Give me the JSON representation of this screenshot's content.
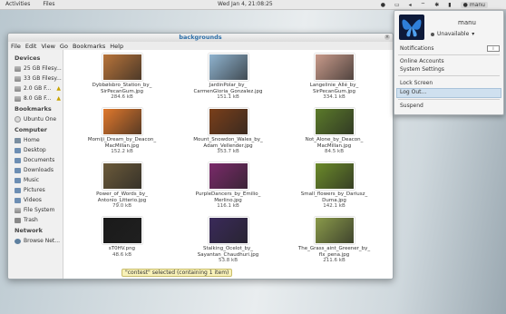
{
  "topbar": {
    "activities": "Activities",
    "files": "Files",
    "clock": "Wed Jan  4, 21:08:25",
    "user": "manu"
  },
  "window": {
    "title": "backgrounds",
    "menus": [
      "File",
      "Edit",
      "View",
      "Go",
      "Bookmarks",
      "Help"
    ]
  },
  "sidebar": {
    "devices_heading": "Devices",
    "devices": [
      "25 GB Filesy...",
      "33 GB Filesy...",
      "2.0 GB F...",
      "8.0 GB F..."
    ],
    "bookmarks_heading": "Bookmarks",
    "bookmarks": [
      "Ubuntu One"
    ],
    "computer_heading": "Computer",
    "computer": [
      "Home",
      "Desktop",
      "Documents",
      "Downloads",
      "Music",
      "Pictures",
      "Videos",
      "File System",
      "Trash"
    ],
    "network_heading": "Network",
    "network": [
      "Browse Net..."
    ]
  },
  "files": [
    {
      "name": "Dybbølsbro_Station_by_ SirPecanGum.jpg",
      "size": "284.6 kB",
      "color": "#b8743a"
    },
    {
      "name": "JardinPolar_by_ CarmenGloria_Gonzalez.jpg",
      "size": "151.1 kB",
      "color": "#8fb3cf"
    },
    {
      "name": "Langelinie_Allé_by_ SirPecanGum.jpg",
      "size": "334.1 kB",
      "color": "#c89a8a"
    },
    {
      "name": "Momiji_Dream_by_Deacon_ MacMillan.jpg",
      "size": "152.2 kB",
      "color": "#e0782c"
    },
    {
      "name": "Mount_Snowdon_Wales_by_ Adam_Vellender.jpg",
      "size": "353.7 kB",
      "color": "#7a3f1a"
    },
    {
      "name": "Not_Alone_by_Deacon_ MacMillan.jpg",
      "size": "84.5 kB",
      "color": "#5b7a2a"
    },
    {
      "name": "Power_of_Words_by_ Antonio_Litterio.jpg",
      "size": "79.0 kB",
      "color": "#6b5a3a"
    },
    {
      "name": "PurpleDancers_by_Emilio_ Merlino.jpg",
      "size": "116.1 kB",
      "color": "#7a2a6a"
    },
    {
      "name": "Small_flowers_by_Dariusz_ Duma.jpg",
      "size": "142.1 kB",
      "color": "#6b8a2a"
    },
    {
      "name": "sT0HV.png",
      "size": "48.6 kB",
      "color": "#1a1a1a"
    },
    {
      "name": "Stalking_Ocelot_by_ Sayantan_Chaudhuri.jpg",
      "size": "53.8 kB",
      "color": "#3a2a5a"
    },
    {
      "name": "The_Grass_aint_Greener_by_ flx_pena.jpg",
      "size": "211.6 kB",
      "color": "#8a9a4a"
    }
  ],
  "status": "\"contest\" selected (containing 1 item)",
  "user_menu": {
    "name": "manu",
    "status": "Unavailable",
    "notifications": "Notifications",
    "toggle": "I",
    "online_accounts": "Online Accounts",
    "system_settings": "System Settings",
    "lock_screen": "Lock Screen",
    "log_out": "Log Out...",
    "suspend": "Suspend"
  }
}
